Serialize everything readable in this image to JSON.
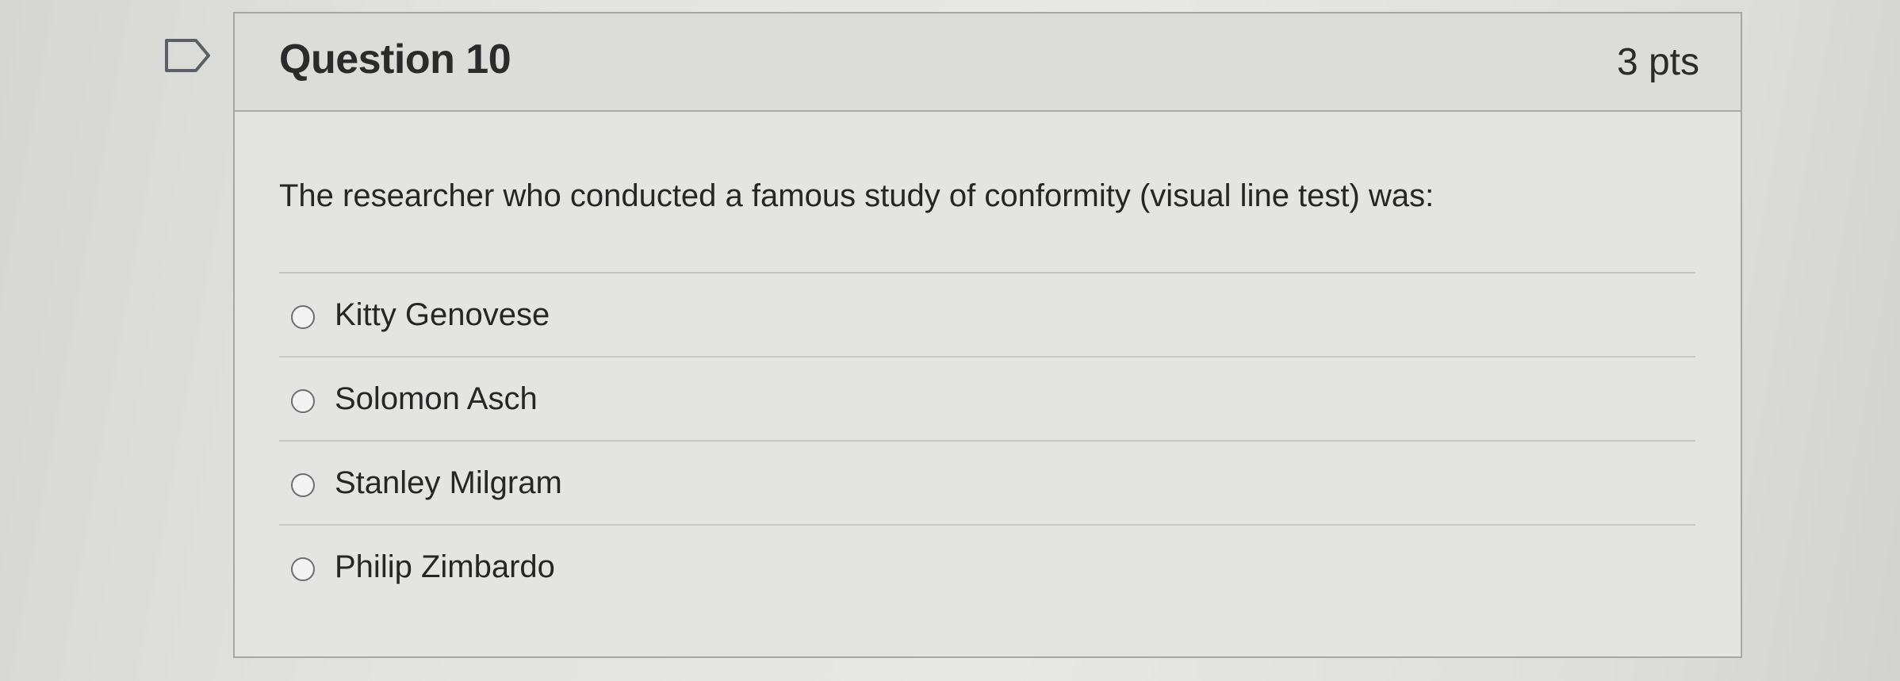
{
  "question": {
    "title": "Question 10",
    "points": "3 pts",
    "text": "The researcher who conducted a famous study of conformity (visual line test) was:",
    "flag_icon": "flag-icon"
  },
  "answers": [
    {
      "label": "Kitty Genovese",
      "selected": false
    },
    {
      "label": "Solomon Asch",
      "selected": false
    },
    {
      "label": "Stanley Milgram",
      "selected": false
    },
    {
      "label": "Philip Zimbardo",
      "selected": false
    }
  ],
  "colors": {
    "text": "#262626",
    "border": "#a6a7a4",
    "header_bg": "#dcdcd9"
  }
}
